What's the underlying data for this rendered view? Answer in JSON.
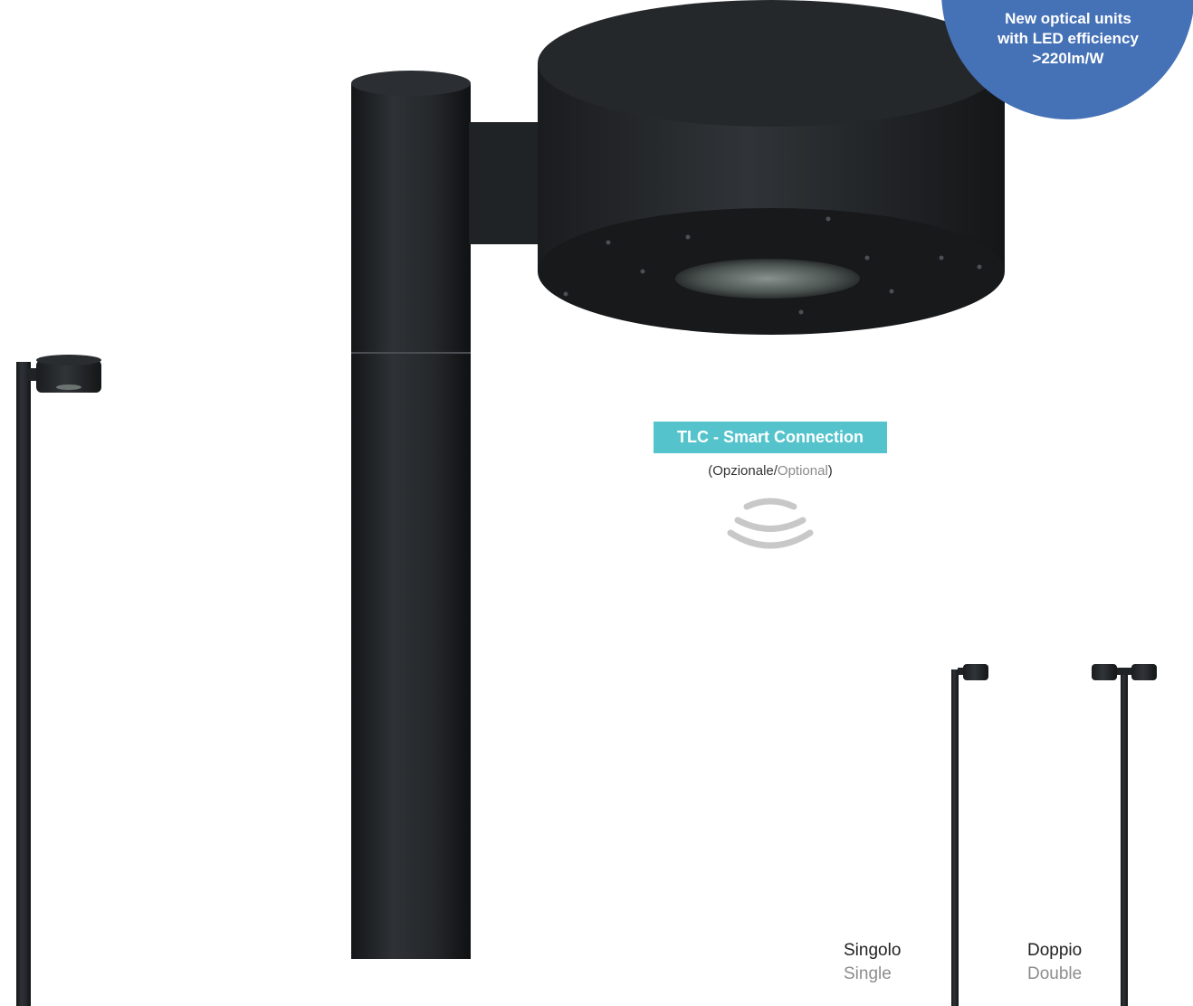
{
  "badge": {
    "line1": "New optical units",
    "line2": "with LED efficiency",
    "line3": ">220lm/W",
    "color": "#4571b6"
  },
  "tlc": {
    "label": "TLC - Smart Connection",
    "optional_it": "Opzionale",
    "optional_en": "Optional",
    "color": "#55c3cc"
  },
  "variants": {
    "single": {
      "it": "Singolo",
      "en": "Single"
    },
    "double": {
      "it": "Doppio",
      "en": "Double"
    }
  }
}
